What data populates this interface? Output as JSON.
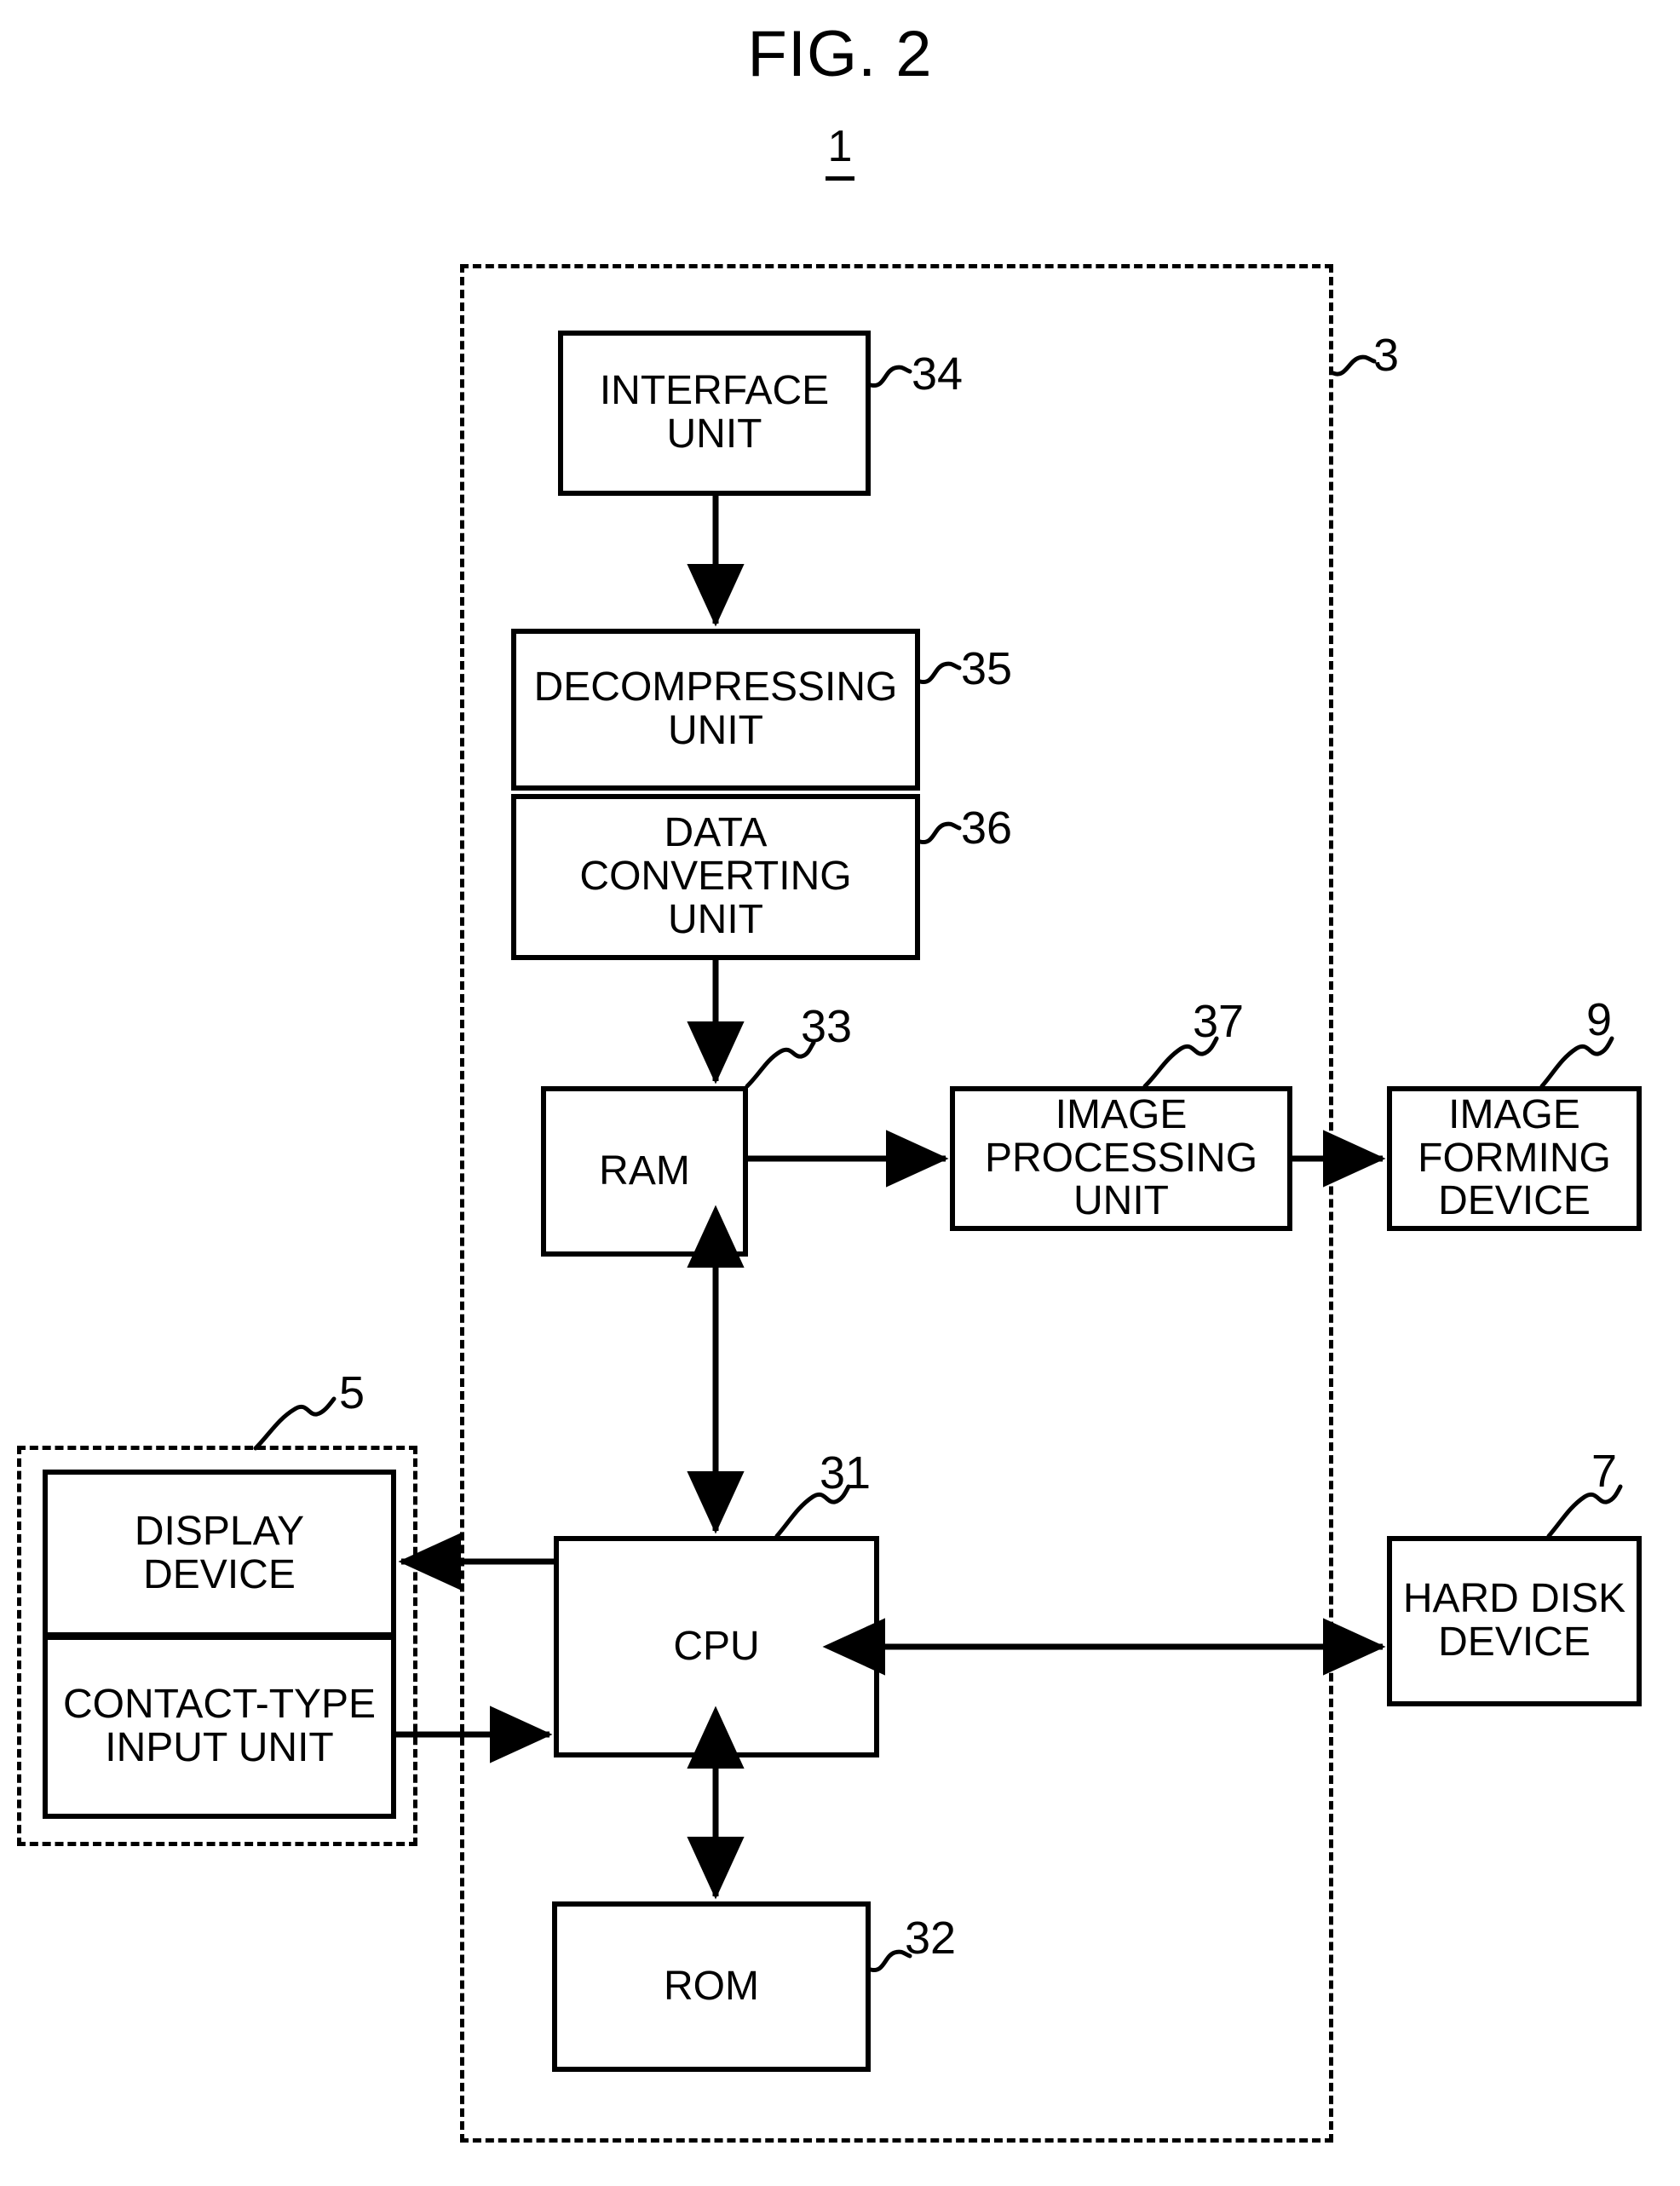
{
  "figure": {
    "title": "FIG. 2",
    "system_ref": "1"
  },
  "enclosures": [
    {
      "name": "controller-enclosure",
      "ref": "3"
    },
    {
      "name": "operation-panel-enclosure",
      "ref": "5"
    }
  ],
  "blocks": {
    "interface_unit": {
      "label": "INTERFACE\nUNIT",
      "ref": "34"
    },
    "decompressing_unit": {
      "label": "DECOMPRESSING\nUNIT",
      "ref": "35"
    },
    "data_converting_unit": {
      "label": "DATA\nCONVERTING\nUNIT",
      "ref": "36"
    },
    "ram": {
      "label": "RAM",
      "ref": "33"
    },
    "image_processing_unit": {
      "label": "IMAGE\nPROCESSING\nUNIT",
      "ref": "37"
    },
    "image_forming_device": {
      "label": "IMAGE\nFORMING\nDEVICE",
      "ref": "9"
    },
    "display_device": {
      "label": "DISPLAY\nDEVICE",
      "ref": ""
    },
    "contact_type_input_unit": {
      "label": "CONTACT-TYPE\nINPUT UNIT",
      "ref": ""
    },
    "cpu": {
      "label": "CPU",
      "ref": "31"
    },
    "hard_disk_device": {
      "label": "HARD DISK\nDEVICE",
      "ref": "7"
    },
    "rom": {
      "label": "ROM",
      "ref": "32"
    }
  },
  "colors": {
    "stroke": "#000000",
    "background": "#ffffff"
  },
  "connections": [
    {
      "from": "interface_unit",
      "to": "decompressing_unit",
      "style": "single-arrow-down"
    },
    {
      "from": "data_converting_unit",
      "to": "ram",
      "style": "single-arrow-down"
    },
    {
      "from": "ram",
      "to": "image_processing_unit",
      "style": "single-arrow-right"
    },
    {
      "from": "image_processing_unit",
      "to": "image_forming_device",
      "style": "single-arrow-right"
    },
    {
      "from": "ram",
      "to": "cpu",
      "style": "double-arrow-vertical"
    },
    {
      "from": "cpu",
      "to": "display_device",
      "style": "single-arrow-left"
    },
    {
      "from": "contact_type_input_unit",
      "to": "cpu",
      "style": "single-arrow-right"
    },
    {
      "from": "cpu",
      "to": "hard_disk_device",
      "style": "double-arrow-horizontal"
    },
    {
      "from": "cpu",
      "to": "rom",
      "style": "double-arrow-vertical"
    }
  ]
}
